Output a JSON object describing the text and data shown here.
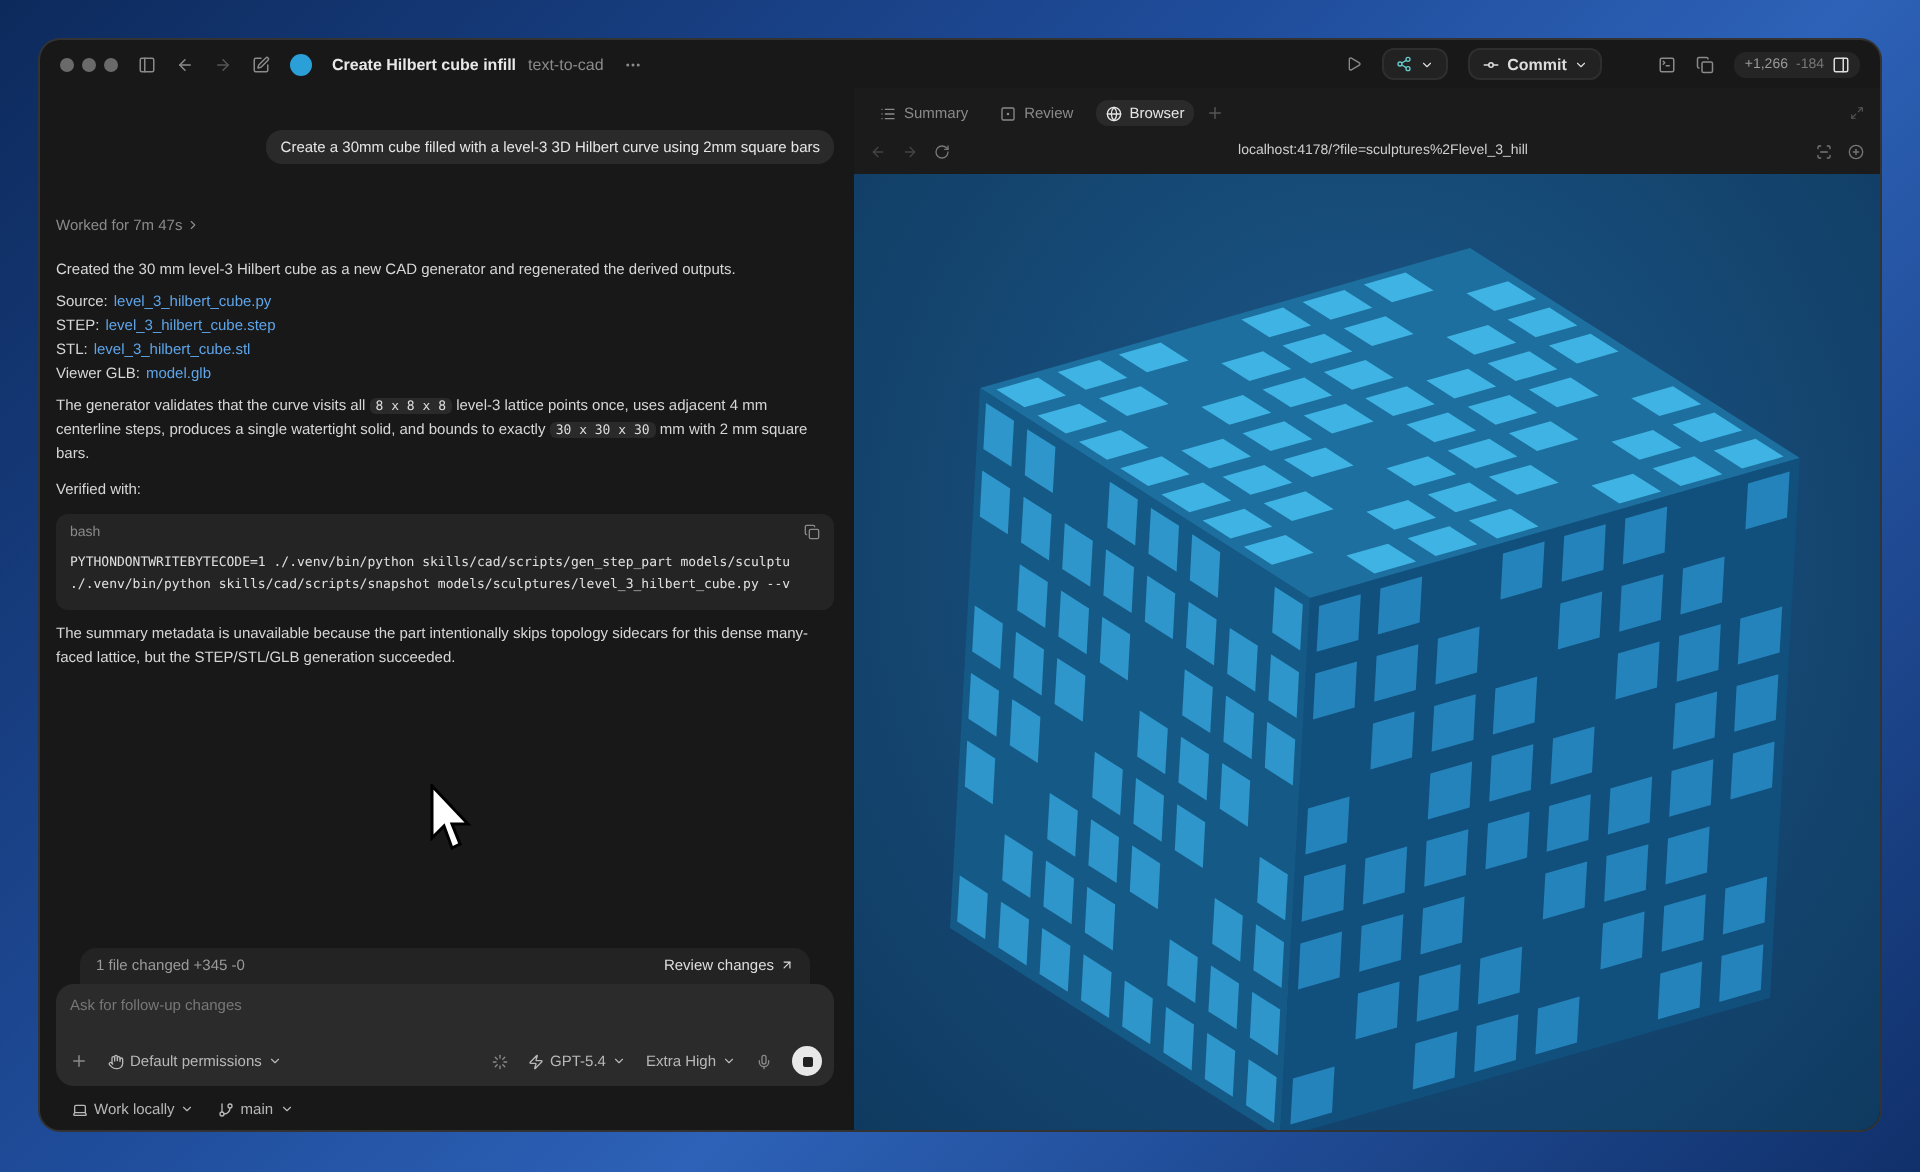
{
  "window": {
    "title": "Create Hilbert cube infill",
    "subtitle": "text-to-cad"
  },
  "toolbar": {
    "commit": "Commit",
    "diff_added": "+1,266",
    "diff_removed": "-184"
  },
  "chat": {
    "user_message": "Create a 30mm cube filled with a level-3 3D Hilbert curve using 2mm square bars",
    "worked": "Worked for 7m 47s",
    "intro": "Created the 30 mm level-3 Hilbert cube as a new CAD generator and regenerated the derived outputs.",
    "files": [
      {
        "label": "Source:",
        "link": "level_3_hilbert_cube.py"
      },
      {
        "label": "STEP:",
        "link": "level_3_hilbert_cube.step"
      },
      {
        "label": "STL:",
        "link": "level_3_hilbert_cube.stl"
      },
      {
        "label": "Viewer GLB:",
        "link": "model.glb"
      }
    ],
    "validation": [
      {
        "kind": "text",
        "text": "The generator validates that the curve visits all"
      },
      {
        "kind": "code",
        "text": "8 x 8 x 8"
      },
      {
        "kind": "text",
        "text": "level-3 lattice points once, uses adjacent 4 mm centerline steps, produces a single watertight solid, and bounds to exactly"
      },
      {
        "kind": "code",
        "text": "30 x 30 x 30"
      },
      {
        "kind": "text",
        "text": "mm with 2 mm square bars."
      }
    ],
    "verified": "Verified with:",
    "code_block": {
      "language": "bash",
      "lines": [
        "PYTHONDONTWRITEBYTECODE=1 ./.venv/bin/python skills/cad/scripts/gen_step_part models/sculptu",
        "./.venv/bin/python skills/cad/scripts/snapshot models/sculptures/level_3_hilbert_cube.py --v"
      ]
    },
    "summary": "The summary metadata is unavailable because the part intentionally skips topology sidecars for this dense many-faced lattice, but the STEP/STL/GLB generation succeeded."
  },
  "changes": {
    "files": "1 file changed",
    "added": "+345",
    "removed": "-0",
    "review": "Review changes"
  },
  "composer": {
    "placeholder": "Ask for follow-up changes",
    "permissions": "Default permissions",
    "model": "GPT-5.4",
    "effort": "Extra High"
  },
  "footer": {
    "location": "Work locally",
    "branch": "main"
  },
  "panel": {
    "tabs": [
      {
        "label": "Summary",
        "kind": "list",
        "selected": false
      },
      {
        "label": "Review",
        "kind": "review",
        "selected": false
      },
      {
        "label": "Browser",
        "kind": "globe",
        "selected": true
      }
    ],
    "url": "localhost:4178/?file=sculptures%2Flevel_3_hill"
  }
}
